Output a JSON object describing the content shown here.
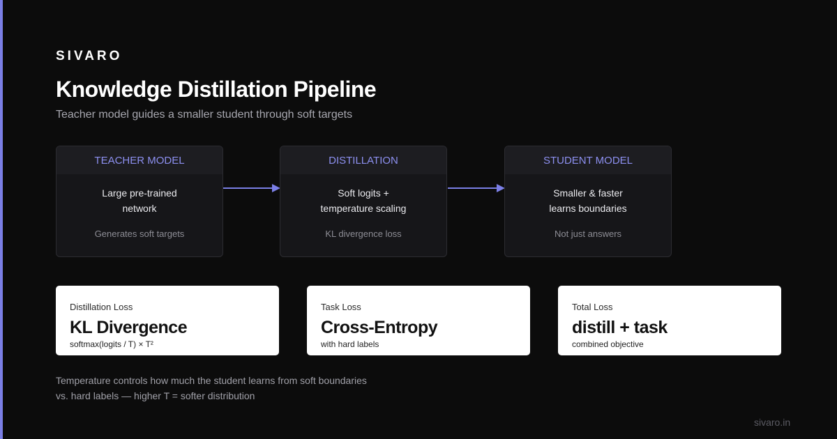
{
  "brand": "SIVARO",
  "title": "Knowledge Distillation Pipeline",
  "subtitle": "Teacher model guides a smaller student through soft targets",
  "stages": [
    {
      "header": "TEACHER MODEL",
      "lines": [
        "Large pre-trained",
        "network"
      ],
      "note": "Generates soft targets"
    },
    {
      "header": "DISTILLATION",
      "lines": [
        "Soft logits +",
        "temperature scaling"
      ],
      "note": "KL divergence loss"
    },
    {
      "header": "STUDENT MODEL",
      "lines": [
        "Smaller & faster",
        "learns boundaries"
      ],
      "note": "Not just answers"
    }
  ],
  "losses": [
    {
      "label": "Distillation Loss",
      "value": "KL Divergence",
      "detail": "softmax(logits / T) × T²"
    },
    {
      "label": "Task Loss",
      "value": "Cross-Entropy",
      "detail": "with hard labels"
    },
    {
      "label": "Total Loss",
      "value": "distill + task",
      "detail": "combined objective"
    }
  ],
  "footnote": [
    "Temperature controls how much the student learns from soft boundaries",
    "vs. hard labels — higher T = softer distribution"
  ],
  "site": "sivaro.in",
  "colors": {
    "accent": "#7b7fe6",
    "background": "#0c0c0c",
    "card": "#161619",
    "loss_card": "#ffffff"
  },
  "icons": [
    "arrow-right-icon"
  ]
}
